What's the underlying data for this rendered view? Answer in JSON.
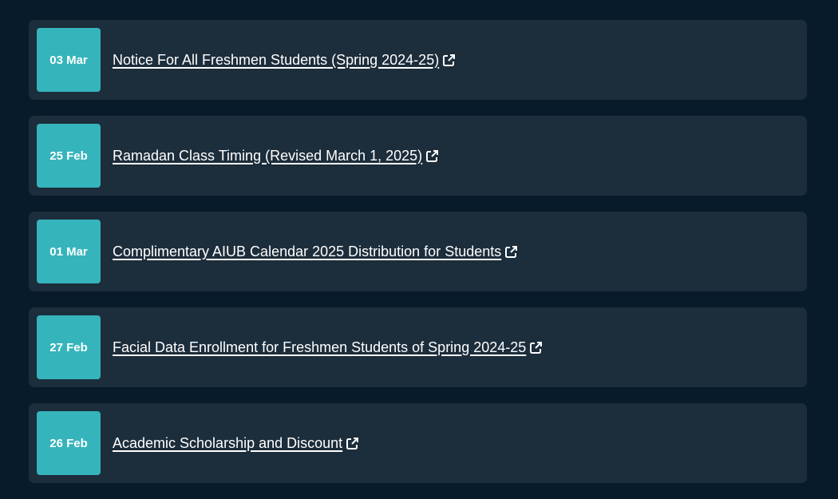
{
  "notices": [
    {
      "date": "03 Mar",
      "title": "Notice For All Freshmen Students (Spring 2024-25)",
      "icon": "external-link-icon"
    },
    {
      "date": "25 Feb",
      "title": "Ramadan Class Timing (Revised March 1, 2025)",
      "icon": "external-link-icon"
    },
    {
      "date": "01 Mar",
      "title": "Complimentary AIUB Calendar 2025 Distribution for Students",
      "icon": "external-link-icon"
    },
    {
      "date": "27 Feb",
      "title": "Facial Data Enrollment for Freshmen Students of Spring 2024-25",
      "icon": "external-link-icon"
    },
    {
      "date": "26 Feb",
      "title": "Academic Scholarship and Discount",
      "icon": "external-link-icon"
    }
  ],
  "colors": {
    "background": "#071b2b",
    "card": "#1c2d3b",
    "badge": "#35b4bc",
    "text": "#ffffff"
  }
}
